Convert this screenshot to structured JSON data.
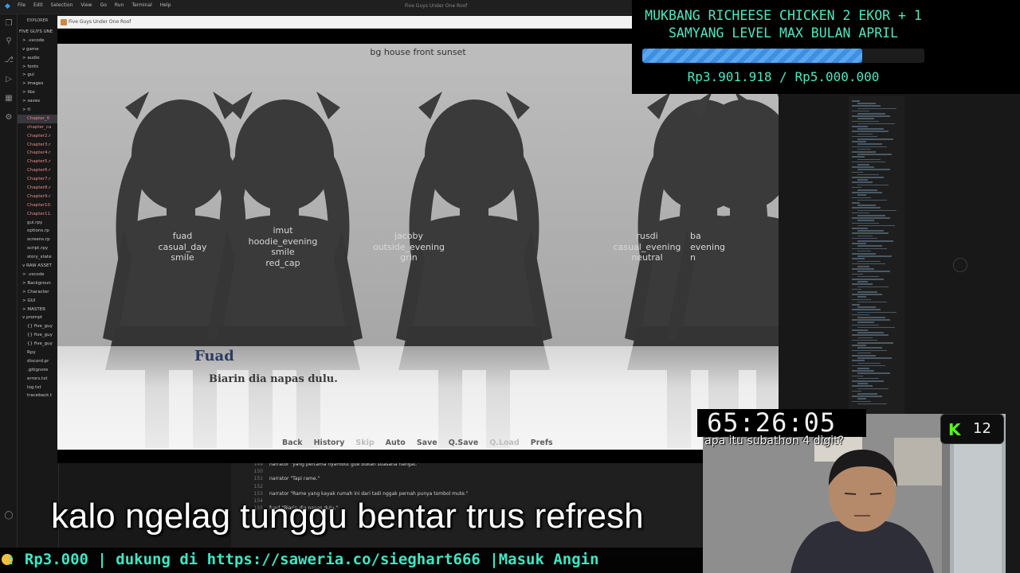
{
  "vscode": {
    "menu": [
      "File",
      "Edit",
      "Selection",
      "View",
      "Go",
      "Run",
      "Terminal",
      "Help"
    ],
    "title": "Five Guys Under One Roof",
    "explorer_title": "EXPLORER",
    "explorer_items": [
      "FIVE GUYS UNE",
      "> .vscode",
      "v game",
      "> audio",
      "> fonts",
      "> gui",
      "> images",
      "> libs",
      "> saves",
      "> tl",
      "Chapter_0",
      "chapter_ca",
      "Chapter2.r",
      "Chapter3.r",
      "Chapter4.r",
      "Chapter5.r",
      "Chapter6.r",
      "Chapter7.r",
      "Chapter8.r",
      "Chapter9.r",
      "Chapter10.",
      "Chapter11.",
      "gui.rpy",
      "options.rp",
      "screens.rp",
      "script.rpy",
      "story_state",
      "v RAW ASSET",
      "> .vscode",
      "> Backgroun",
      "> Character",
      "> GUI",
      "> MASTER",
      "v prompt",
      "{} five_guy",
      "{} five_guy",
      "{} five_guy",
      "Rpy",
      "discord.pr",
      ".gitignore",
      "errors.txt",
      "log.txt",
      "traceback.t"
    ],
    "code_lines": [
      {
        "n": "149",
        "text": "narrator \"yang pertama nyambut gue bukan suasana hangat.\""
      },
      {
        "n": "150",
        "text": ""
      },
      {
        "n": "151",
        "text": "narrator \"Tapi rame.\""
      },
      {
        "n": "152",
        "text": ""
      },
      {
        "n": "153",
        "text": "narrator \"Rame yang kayak rumah ini dari tadi nggak pernah punya tombol mute.\""
      },
      {
        "n": "154",
        "text": ""
      },
      {
        "n": "155",
        "text": "fuad \"Biarin dia napas dulu.\""
      }
    ]
  },
  "game": {
    "window_title": "Five Guys Under One Roof",
    "bg_label": "bg house front sunset",
    "characters": [
      {
        "name": "fuad",
        "lines": [
          "fuad",
          "casual_day",
          "smile"
        ]
      },
      {
        "name": "imut",
        "lines": [
          "imut",
          "hoodie_evening",
          "smile",
          "red_cap"
        ]
      },
      {
        "name": "jacoby",
        "lines": [
          "jacoby",
          "outside_evening",
          "grin"
        ]
      },
      {
        "name": "rusdi",
        "lines": [
          "rusdi",
          "casual_evening",
          "neutral"
        ]
      },
      {
        "name": "ba",
        "lines": [
          "ba",
          "evening",
          "n"
        ]
      }
    ],
    "speaker": "Fuad",
    "dialogue": "Biarin dia napas dulu.",
    "quick_menu": [
      {
        "label": "Back",
        "enabled": true
      },
      {
        "label": "History",
        "enabled": true
      },
      {
        "label": "Skip",
        "enabled": false
      },
      {
        "label": "Auto",
        "enabled": true
      },
      {
        "label": "Save",
        "enabled": true
      },
      {
        "label": "Q.Save",
        "enabled": true
      },
      {
        "label": "Q.Load",
        "enabled": false
      },
      {
        "label": "Prefs",
        "enabled": true
      }
    ]
  },
  "goal": {
    "title_line1": "MUKBANG RICHEESE CHICKEN 2 EKOR + 1",
    "title_line2": "SAMYANG LEVEL MAX BULAN APRIL",
    "amount_text": "Rp3.901.918 / Rp5.000.000",
    "progress": 0.78,
    "accent": "#4fe8c0",
    "bar_color": "#3f8fe0"
  },
  "timer": {
    "text": "65:26:05"
  },
  "chat_overlay": "apa itu subathon 4 digit?",
  "kick": {
    "count": "12",
    "color": "#53fc18"
  },
  "subtitle": "kalo ngelag tunggu bentar trus refresh",
  "ticker": {
    "text": ": Rp3.000 |  dukung di https://saweria.co/sieghart666 |Masuk Angin"
  }
}
